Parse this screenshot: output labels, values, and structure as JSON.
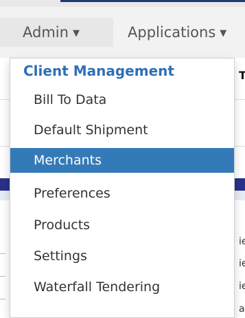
{
  "nav": {
    "admin_label": "Admin",
    "applications_label": "Applications",
    "caret": "▼"
  },
  "dropdown": {
    "header": "Client Management",
    "items": [
      {
        "label": "Bill To Data"
      },
      {
        "label": "Default Shipment"
      },
      {
        "label": "Merchants"
      },
      {
        "label": "Preferences"
      },
      {
        "label": "Products"
      },
      {
        "label": "Settings"
      },
      {
        "label": "Waterfall Tendering"
      }
    ],
    "active_item": "Merchants"
  },
  "background": {
    "partial_heading": "T",
    "row_fragments": [
      "ie",
      "ie",
      "ie",
      "ax"
    ]
  },
  "colors": {
    "header_blue": "#2f6fb7",
    "active_bg": "#357ab8",
    "band_navy": "#29318a"
  }
}
